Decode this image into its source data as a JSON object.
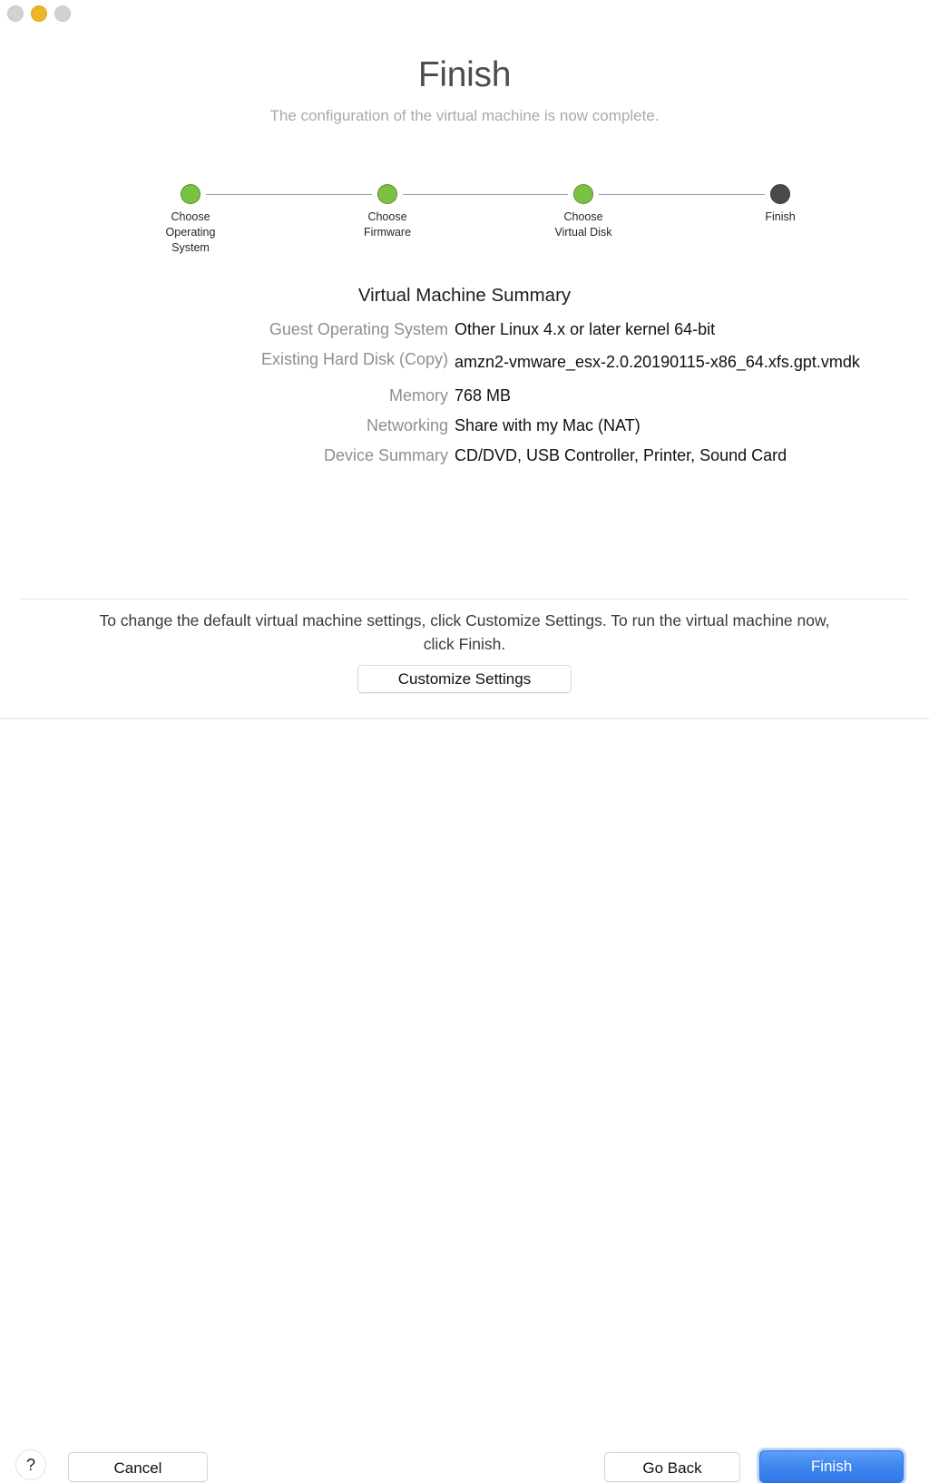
{
  "window": {
    "traffic_lights": [
      {
        "name": "close",
        "color": "#d2d2d4",
        "enabled": false
      },
      {
        "name": "minimize",
        "color": "#f0b429",
        "enabled": true
      },
      {
        "name": "zoom",
        "color": "#d2d2d4",
        "enabled": false
      }
    ]
  },
  "header": {
    "title": "Finish",
    "subtitle": "The configuration of the virtual machine is now complete."
  },
  "stepper": {
    "done_color": "#7cc242",
    "current_color": "#4a4a4c",
    "steps": [
      {
        "label": "Choose\nOperating\nSystem",
        "state": "done"
      },
      {
        "label": "Choose\nFirmware",
        "state": "done"
      },
      {
        "label": "Choose\nVirtual Disk",
        "state": "done"
      },
      {
        "label": "Finish",
        "state": "current"
      }
    ]
  },
  "summary": {
    "title": "Virtual Machine Summary",
    "rows": [
      {
        "label": "Guest Operating System",
        "value": "Other Linux 4.x or later kernel 64-bit"
      },
      {
        "label": "Existing Hard Disk (Copy)",
        "value": "amzn2-vmware_esx-2.0.20190115-x86_64.xfs.gpt.vmdk"
      },
      {
        "label": "Memory",
        "value": "768 MB"
      },
      {
        "label": "Networking",
        "value": "Share with my Mac (NAT)"
      },
      {
        "label": "Device Summary",
        "value": "CD/DVD, USB Controller, Printer, Sound Card"
      }
    ]
  },
  "hint": {
    "text": "To change the default virtual machine settings, click Customize Settings. To run the virtual machine now, click Finish."
  },
  "buttons": {
    "customize": "Customize Settings",
    "help": "?",
    "cancel": "Cancel",
    "go_back": "Go Back",
    "finish": "Finish",
    "finish_accent": "#3f87ef"
  }
}
